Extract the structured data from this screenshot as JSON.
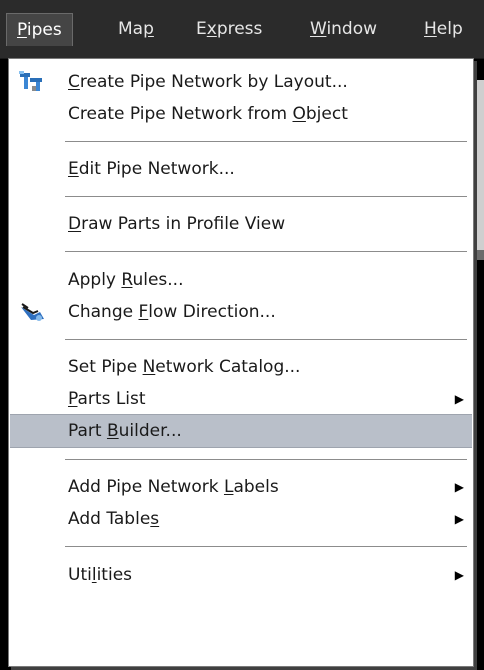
{
  "menubar": {
    "items": [
      {
        "pre": "",
        "key": "P",
        "post": "ipes"
      },
      {
        "pre": "Ma",
        "key": "p",
        "post": ""
      },
      {
        "pre": "E",
        "key": "x",
        "post": "press"
      },
      {
        "pre": "",
        "key": "W",
        "post": "indow"
      },
      {
        "pre": "",
        "key": "H",
        "post": "elp"
      }
    ]
  },
  "menu": {
    "items": [
      {
        "pre": "",
        "key": "C",
        "post": "reate Pipe Network by Layout..."
      },
      {
        "pre": "Create Pipe Network from ",
        "key": "O",
        "post": "bject"
      },
      {
        "pre": "",
        "key": "E",
        "post": "dit Pipe Network..."
      },
      {
        "pre": "",
        "key": "D",
        "post": "raw Parts in Profile View"
      },
      {
        "pre": "Apply ",
        "key": "R",
        "post": "ules..."
      },
      {
        "pre": "Change ",
        "key": "F",
        "post": "low Direction..."
      },
      {
        "pre": "Set Pipe ",
        "key": "N",
        "post": "etwork Catalog..."
      },
      {
        "pre": "",
        "key": "P",
        "post": "arts List"
      },
      {
        "pre": "Part ",
        "key": "B",
        "post": "uilder..."
      },
      {
        "pre": "Add Pipe Network ",
        "key": "L",
        "post": "abels"
      },
      {
        "pre": "Add Table",
        "key": "s",
        "post": ""
      },
      {
        "pre": "Uti",
        "key": "l",
        "post": "ities"
      }
    ],
    "arrow": "▶",
    "icons": {
      "create_layout": "pipe-network-layout-icon",
      "change_flow": "flow-direction-icon"
    },
    "highlight_color": "#b9bfc9"
  }
}
